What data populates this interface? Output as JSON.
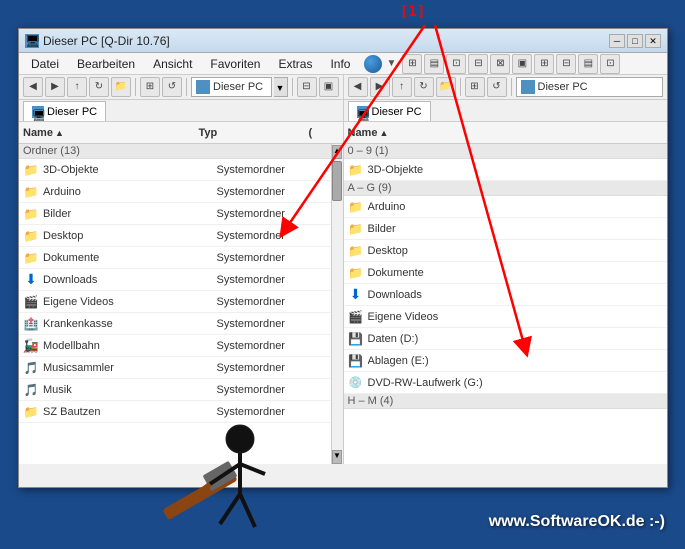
{
  "window": {
    "title": "Dieser PC  [Q-Dir 10.76]",
    "title_icon": "computer"
  },
  "menu": {
    "items": [
      "Datei",
      "Bearbeiten",
      "Ansicht",
      "Favoriten",
      "Extras",
      "Info"
    ]
  },
  "toolbar": {
    "address_left": "Dieser PC",
    "address_right": "Dieser PC"
  },
  "left_pane": {
    "tab_label": "Dieser PC",
    "columns": {
      "name": "Name",
      "type": "Typ",
      "extra": "("
    },
    "section_ordner": "Ordner (13)",
    "files": [
      {
        "name": "3D-Objekte",
        "type": "Systemordner",
        "icon": "folder"
      },
      {
        "name": "Arduino",
        "type": "Systemordner",
        "icon": "folder"
      },
      {
        "name": "Bilder",
        "type": "Systemordner",
        "icon": "folder"
      },
      {
        "name": "Desktop",
        "type": "Systemordner",
        "icon": "folder"
      },
      {
        "name": "Dokumente",
        "type": "Systemordner",
        "icon": "folder"
      },
      {
        "name": "Downloads",
        "type": "Systemordner",
        "icon": "download"
      },
      {
        "name": "Eigene Videos",
        "type": "Systemordner",
        "icon": "video"
      },
      {
        "name": "Krankenkasse",
        "type": "Systemordner",
        "icon": "health"
      },
      {
        "name": "Modellbahn",
        "type": "Systemordner",
        "icon": "train"
      },
      {
        "name": "Musicsammler",
        "type": "Systemordner",
        "icon": "music"
      },
      {
        "name": "Musik",
        "type": "Systemordner",
        "icon": "music2"
      },
      {
        "name": "SZ Bautzen",
        "type": "Systemordner",
        "icon": "folder"
      }
    ]
  },
  "right_pane": {
    "tab_label": "Dieser PC",
    "columns": {
      "name": "Name"
    },
    "section_09": "0 – 9 (1)",
    "section_ag": "A – G (9)",
    "files_09": [
      {
        "name": "3D-Objekte",
        "icon": "folder"
      }
    ],
    "files_ag": [
      {
        "name": "Arduino",
        "icon": "folder"
      },
      {
        "name": "Bilder",
        "icon": "folder"
      },
      {
        "name": "Desktop",
        "icon": "folder"
      },
      {
        "name": "Dokumente",
        "icon": "folder"
      },
      {
        "name": "Downloads",
        "icon": "download"
      },
      {
        "name": "Eigene Videos",
        "icon": "video"
      },
      {
        "name": "Daten (D:)",
        "icon": "drive"
      },
      {
        "name": "Ablagen (E:)",
        "icon": "drive"
      },
      {
        "name": "DVD-RW-Laufwerk (G:)",
        "icon": "dvd"
      }
    ],
    "files_hm": [
      {
        "name": "H – M (4)",
        "icon": "folder"
      }
    ]
  },
  "annotation": {
    "number": "[1]",
    "watermark": "www.SoftwareOK.de :-)"
  }
}
